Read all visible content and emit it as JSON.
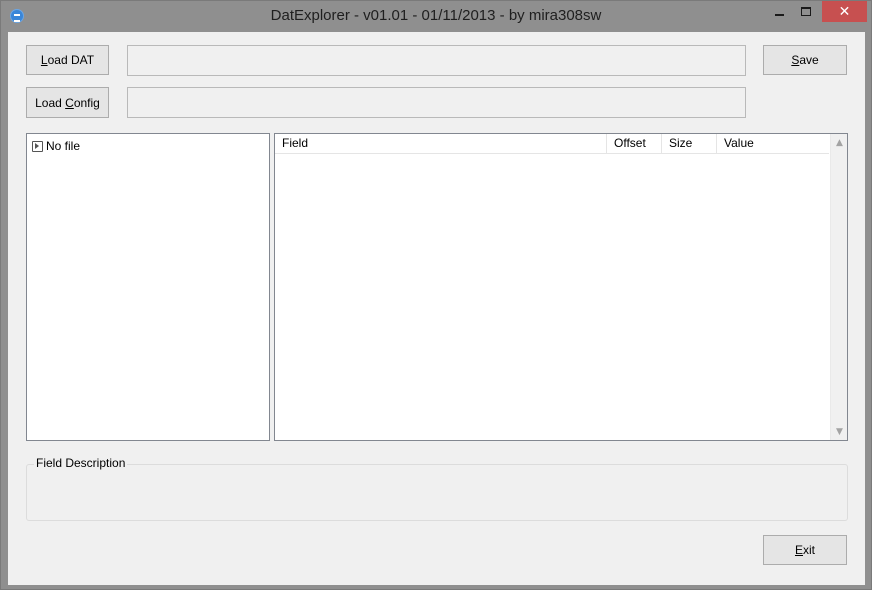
{
  "window": {
    "title": "DatExplorer - v01.01 - 01/11/2013 - by mira308sw",
    "close_glyph": "✕"
  },
  "buttons": {
    "load_dat": {
      "accel": "L",
      "rest": "oad DAT"
    },
    "load_config_first": "Load ",
    "load_config_accel": "C",
    "load_config_rest": "onfig",
    "save": {
      "accel": "S",
      "rest": "ave"
    },
    "exit": {
      "accel": "E",
      "rest": "xit"
    }
  },
  "fields": {
    "dat_path": "",
    "config_path": ""
  },
  "tree": {
    "root_label": "No file"
  },
  "list": {
    "columns": [
      "Field",
      "Offset",
      "Size",
      "Value"
    ]
  },
  "description": {
    "title": "Field Description"
  },
  "icons": {
    "app": "app-icon",
    "minimize": "minimize-icon",
    "maximize": "maximize-icon",
    "close": "close-icon",
    "tree_expand": "expand-arrow-icon",
    "scroll_up": "chevron-up-icon",
    "scroll_down": "chevron-down-icon"
  }
}
